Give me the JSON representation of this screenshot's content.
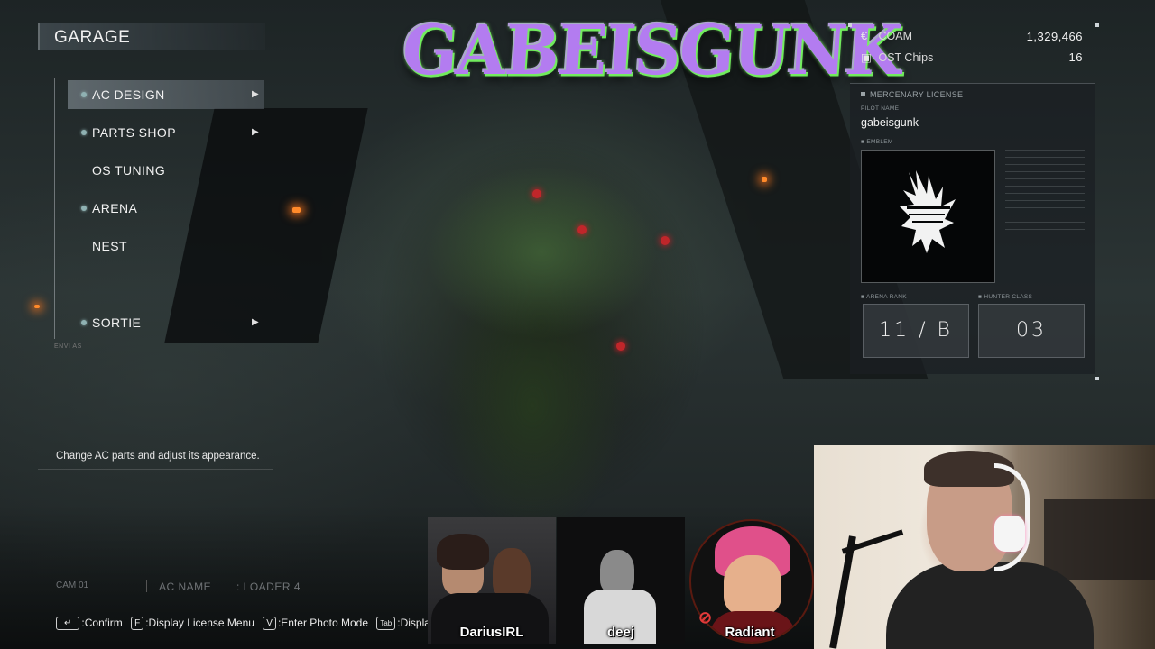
{
  "garage": {
    "title": "GARAGE",
    "menu": [
      {
        "label": "AC DESIGN",
        "dot": true,
        "arrow": true,
        "selected": true
      },
      {
        "label": "PARTS SHOP",
        "dot": true,
        "arrow": true,
        "selected": false
      },
      {
        "label": "OS TUNING",
        "dot": false,
        "arrow": false,
        "selected": false
      },
      {
        "label": "ARENA",
        "dot": true,
        "arrow": false,
        "selected": false
      },
      {
        "label": "NEST",
        "dot": false,
        "arrow": false,
        "selected": false
      },
      {
        "label": "SORTIE",
        "dot": true,
        "arrow": true,
        "selected": false
      }
    ],
    "menu_footer_tag": "ENVI AS",
    "help_text": "Change AC parts and adjust its appearance.",
    "cam_label": "CAM 01",
    "ac_name_label": "AC NAME",
    "ac_name_value": ": LOADER 4"
  },
  "controls": [
    {
      "key": "↵",
      "label": ":Confirm"
    },
    {
      "key": "F",
      "label": ":Display License Menu"
    },
    {
      "key": "V",
      "label": ":Enter Photo Mode"
    },
    {
      "key": "Tab",
      "label": ":Displa"
    }
  ],
  "stream_logo": {
    "text": "GABEISGUNK",
    "colors": {
      "fill": "#b37cf0",
      "glow": "#7ef56a"
    }
  },
  "currency": [
    {
      "icon": "coam-icon",
      "glyph": "€",
      "label": "COAM",
      "value": "1,329,466"
    },
    {
      "icon": "chip-icon",
      "glyph": "▣",
      "label": "OST Chips",
      "value": "16"
    }
  ],
  "license": {
    "header": "MERCENARY LICENSE",
    "pilot_name_label": "PILOT NAME",
    "pilot_name": "gabeisgunk",
    "emblem_label": "EMBLEM",
    "arena_rank_label": "ARENA RANK",
    "arena_rank": "11 / B",
    "hunter_class_label": "HUNTER CLASS",
    "hunter_class": "03"
  },
  "guests": [
    {
      "name": "DariusIRL"
    },
    {
      "name": "deej"
    },
    {
      "name": "Radiant",
      "muted": true
    }
  ]
}
